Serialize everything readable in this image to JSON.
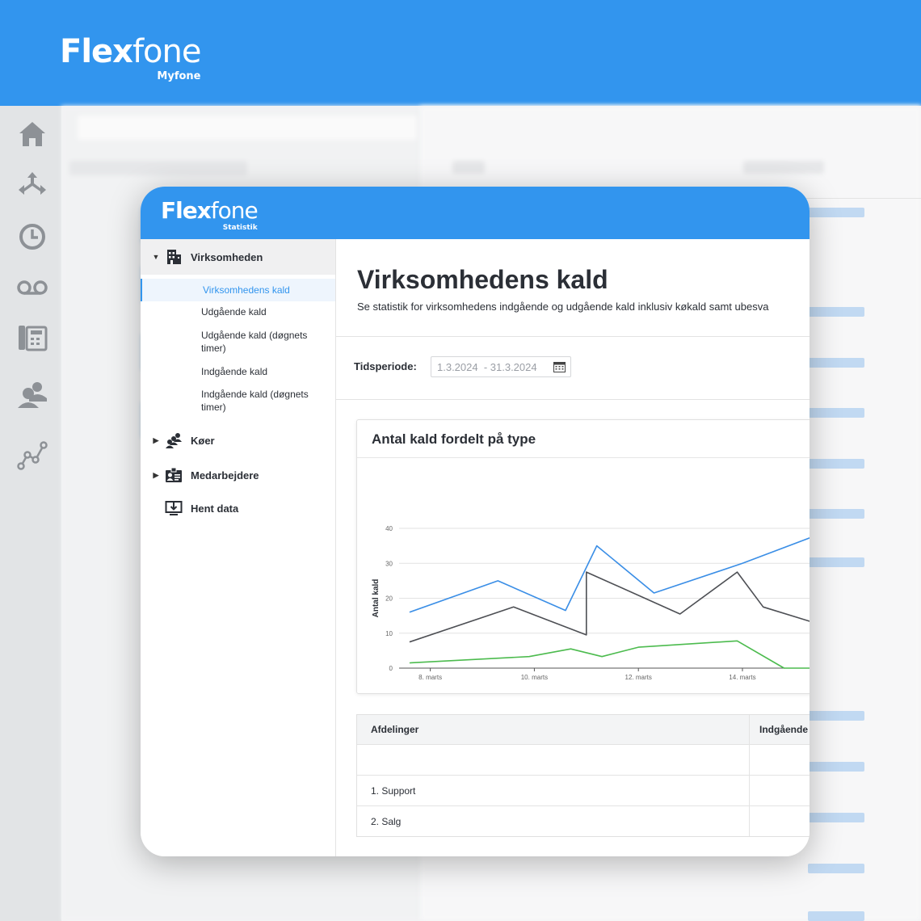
{
  "bg_app": {
    "brand": {
      "name_bold": "Flex",
      "name_thin": "fone",
      "sub": "Myfone"
    },
    "rail_icons": [
      "home-icon",
      "routing-icon",
      "clock-icon",
      "voicemail-icon",
      "desk-phone-icon",
      "users-icon",
      "statistics-icon"
    ]
  },
  "card": {
    "brand": {
      "name_bold": "Flex",
      "name_thin": "fone",
      "sub": "Statistik"
    },
    "sidebar": {
      "sections": [
        {
          "label": "Virksomheden",
          "icon": "building-icon",
          "expanded": true
        },
        {
          "label": "Køer",
          "icon": "queue-icon",
          "expanded": false
        },
        {
          "label": "Medarbejdere",
          "icon": "employee-card-icon",
          "expanded": false
        },
        {
          "label": "Hent data",
          "icon": "download-icon"
        }
      ],
      "items": [
        {
          "label": "Virksomhedens kald",
          "active": true
        },
        {
          "label": "Udgående kald"
        },
        {
          "label": "Udgående kald (døgnets timer)"
        },
        {
          "label": "Indgående kald"
        },
        {
          "label": "Indgående kald (døgnets timer)"
        }
      ]
    },
    "main": {
      "title": "Virksomhedens kald",
      "description": "Se statistik for virksomhedens indgående og udgående kald inklusiv køkald samt ubesva",
      "period_label": "Tidsperiode:",
      "period_value": "1.3.2024  - 31.3.2024"
    },
    "table": {
      "headers": [
        "Afdelinger",
        "Indgående"
      ],
      "rows": [
        [
          "",
          ""
        ],
        [
          "1. Support",
          ""
        ],
        [
          "2. Salg",
          ""
        ]
      ]
    }
  },
  "chart_data": {
    "type": "line",
    "title": "Antal kald fordelt på type",
    "ylabel": "Antal kald",
    "xlabel": "",
    "ylim": [
      0,
      40
    ],
    "yticks": [
      0,
      10,
      20,
      30,
      40
    ],
    "xticks": [
      {
        "x": 8,
        "label": "8. marts"
      },
      {
        "x": 10,
        "label": "10. marts"
      },
      {
        "x": 12,
        "label": "12. marts"
      },
      {
        "x": 14,
        "label": "14. marts"
      }
    ],
    "grid": true,
    "series": [
      {
        "color": "#3a8ee6",
        "points": [
          [
            7.6,
            16
          ],
          [
            9.3,
            25
          ],
          [
            10.6,
            16.5
          ],
          [
            11.2,
            35
          ],
          [
            12.3,
            21.5
          ],
          [
            14,
            30
          ],
          [
            15.6,
            39
          ]
        ]
      },
      {
        "color": "#4d4f54",
        "points": [
          [
            7.6,
            7.5
          ],
          [
            9.6,
            17.5
          ],
          [
            11.0,
            9.5
          ],
          [
            11.0,
            27.5
          ],
          [
            12.8,
            15.5
          ],
          [
            13.9,
            27.5
          ],
          [
            14.4,
            17.5
          ],
          [
            15.6,
            12
          ]
        ]
      },
      {
        "color": "#4cbb4e",
        "points": [
          [
            7.6,
            1.5
          ],
          [
            9.9,
            3.3
          ],
          [
            10.7,
            5.5
          ],
          [
            11.3,
            3.3
          ],
          [
            12.0,
            6
          ],
          [
            13.9,
            7.8
          ],
          [
            14.8,
            0
          ],
          [
            15.6,
            0
          ]
        ]
      }
    ]
  }
}
